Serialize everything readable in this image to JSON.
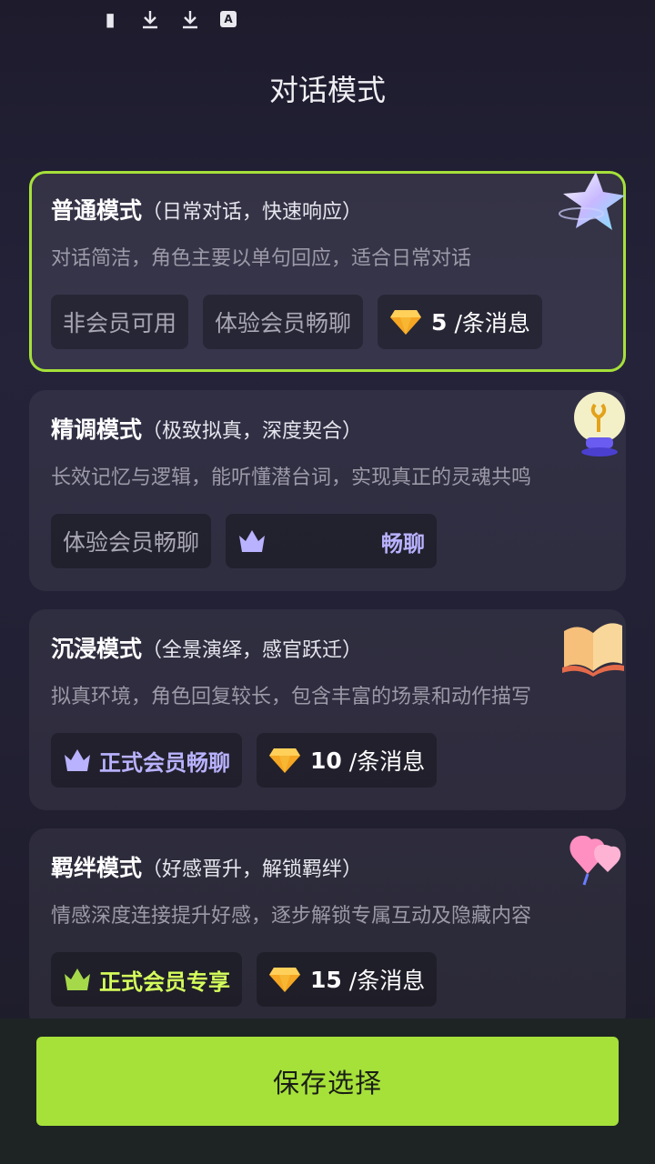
{
  "status_bar": {
    "icons": [
      "notification-icon",
      "download-icon",
      "download-icon",
      "font-icon"
    ],
    "font_icon_label": "A"
  },
  "header": {
    "title": "对话模式"
  },
  "cards": [
    {
      "title": "普通模式",
      "subtitle": "（日常对话，快速响应）",
      "desc": "对话简洁，角色主要以单句回应，适合日常对话",
      "selected": true,
      "tag1": "非会员可用",
      "tag2": "体验会员畅聊",
      "price": "5",
      "unit": "/条消息",
      "deco_icon": "star-icon"
    },
    {
      "title": "精调模式",
      "subtitle": "（极致拟真，深度契合）",
      "desc": "长效记忆与逻辑，能听懂潜台词，实现真正的灵魂共鸣",
      "tag1": "体验会员畅聊",
      "tag2": "畅聊",
      "deco_icon": "lightbulb-icon"
    },
    {
      "title": "沉浸模式",
      "subtitle": "（全景演绎，感官跃迁）",
      "desc": "拟真环境，角色回复较长，包含丰富的场景和动作描写",
      "tag1": "正式会员畅聊",
      "price": "10",
      "unit": "/条消息",
      "deco_icon": "book-icon"
    },
    {
      "title": "羁绊模式",
      "subtitle": "（好感晋升，解锁羁绊）",
      "desc": "情感深度连接提升好感，逐步解锁专属互动及隐藏内容",
      "tag1": "正式会员专享",
      "price": "15",
      "unit": "/条消息",
      "deco_icon": "heart-balloon-icon"
    }
  ],
  "footer": {
    "save_label": "保存选择"
  },
  "colors": {
    "accent": "#a6e13a",
    "background": "#1d1b2c",
    "vip_purple": "#b9b2ff",
    "vip_green": "#d5ff5c"
  }
}
